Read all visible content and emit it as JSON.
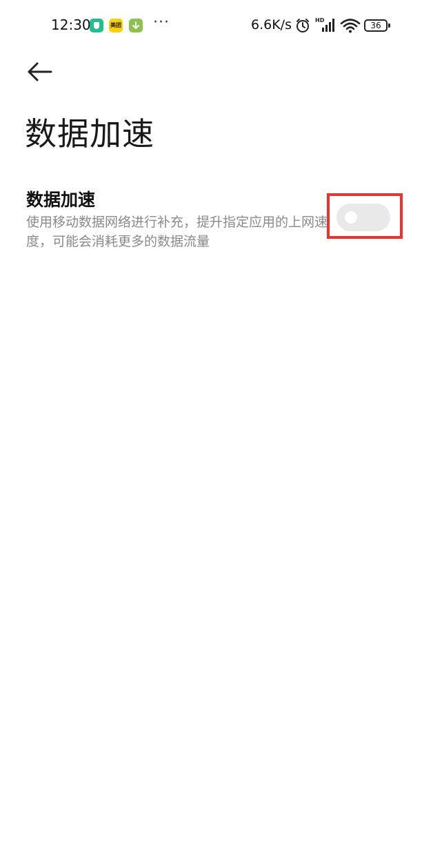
{
  "status_bar": {
    "time": "12:30",
    "meituan_label": "美团",
    "more": "···",
    "net_speed": "6.6K/s",
    "hd_label": "HD",
    "battery": "36",
    "icons": [
      "shield-app-icon",
      "meituan-app-icon",
      "download-app-icon",
      "alarm-icon",
      "signal-icon",
      "wifi-icon",
      "battery-icon"
    ]
  },
  "header": {
    "back_icon": "arrow-left-icon",
    "title": "数据加速"
  },
  "setting": {
    "title": "数据加速",
    "description": "使用移动数据网络进行补充，提升指定应用的上网速度，可能会消耗更多的数据流量",
    "enabled": false
  },
  "colors": {
    "highlight": "#f0302e",
    "toggle_off_track": "#e9e9e9",
    "description_text": "#8a8a8a"
  }
}
